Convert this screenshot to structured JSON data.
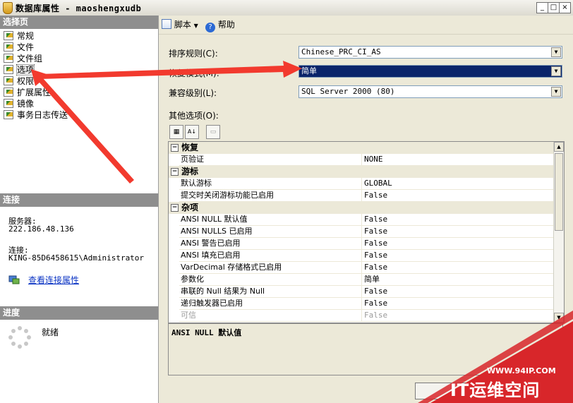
{
  "window": {
    "title": "数据库属性 - maoshengxudb",
    "controls": [
      "_",
      "□",
      "×"
    ]
  },
  "left": {
    "select_page_header": "选择页",
    "pages": [
      {
        "label": "常规",
        "icon": "page-icon"
      },
      {
        "label": "文件",
        "icon": "page-icon"
      },
      {
        "label": "文件组",
        "icon": "page-icon"
      },
      {
        "label": "选项",
        "icon": "page-icon",
        "selected": true
      },
      {
        "label": "权限",
        "icon": "page-icon"
      },
      {
        "label": "扩展属性",
        "icon": "page-icon"
      },
      {
        "label": "镜像",
        "icon": "page-icon"
      },
      {
        "label": "事务日志传送",
        "icon": "page-icon"
      }
    ],
    "connection_header": "连接",
    "server_label": "服务器:",
    "server_value": "222.186.48.136",
    "connection_label": "连接:",
    "connection_value": "KING-85D6458615\\Administrator",
    "view_conn_props": "查看连接属性",
    "progress_header": "进度",
    "progress_status": "就绪"
  },
  "toolbar": {
    "script_label": "脚本",
    "help_label": "帮助"
  },
  "options": {
    "collation_label": "排序规则(C):",
    "collation_value": "Chinese_PRC_CI_AS",
    "recovery_label": "恢复模式(M):",
    "recovery_value": "简单",
    "compat_label": "兼容级别(L):",
    "compat_value": "SQL Server 2000 (80)",
    "other_options_label": "其他选项(O):"
  },
  "grid": {
    "categories": [
      {
        "name": "恢复",
        "rows": [
          {
            "name": "页验证",
            "value": "NONE"
          }
        ]
      },
      {
        "name": "游标",
        "rows": [
          {
            "name": "默认游标",
            "value": "GLOBAL"
          },
          {
            "name": "提交时关闭游标功能已启用",
            "value": "False"
          }
        ]
      },
      {
        "name": "杂项",
        "rows": [
          {
            "name": "ANSI NULL 默认值",
            "value": "False"
          },
          {
            "name": "ANSI NULLS 已启用",
            "value": "False"
          },
          {
            "name": "ANSI 警告已启用",
            "value": "False"
          },
          {
            "name": "ANSI 填充已启用",
            "value": "False"
          },
          {
            "name": "VarDecimal 存储格式已启用",
            "value": "False"
          },
          {
            "name": "参数化",
            "value": "简单"
          },
          {
            "name": "串联的 Null 结果为 Null",
            "value": "False"
          },
          {
            "name": "递归触发器已启用",
            "value": "False"
          },
          {
            "name": "可信",
            "value": "False",
            "disabled": true
          }
        ]
      }
    ],
    "description": "ANSI NULL 默认值"
  },
  "watermark": {
    "url": "WWW.94IP.COM",
    "name": "IT运维空间"
  },
  "colors": {
    "selection": "#0a246a",
    "annotation_arrow": "#f23a2e",
    "watermark": "#d8262a"
  }
}
